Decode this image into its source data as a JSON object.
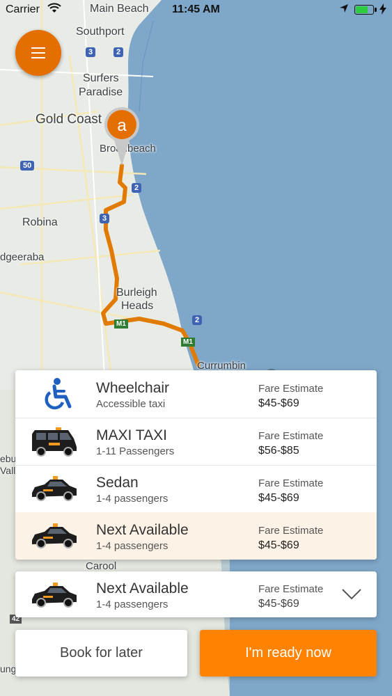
{
  "status_bar": {
    "carrier": "Carrier",
    "time": "11:45 AM"
  },
  "map": {
    "labels": {
      "main_beach": "Main Beach",
      "southport": "Southport",
      "surfers_paradise_1": "Surfers",
      "surfers_paradise_2": "Paradise",
      "gold_coast": "Gold Coast",
      "broadbeach": "Broadbeach",
      "robina": "Robina",
      "mudgeeraba": "dgeeraba",
      "burleigh_1": "Burleigh",
      "burleigh_2": "Heads",
      "currumbin": "Currumbin",
      "carool": "Carool",
      "edge_1": "ebu",
      "edge_2": "Valle",
      "edge_3": "ung"
    },
    "shields": {
      "r3a": "3",
      "r2a": "2",
      "r50": "50",
      "r2b": "2",
      "r3b": "3",
      "r2c": "2",
      "m1a": "M1",
      "m1b": "M1",
      "r42": "42"
    },
    "pin_letter": "a",
    "colors": {
      "route": "#e07a00",
      "water": "#7fa7c9",
      "land": "#e8ebe6",
      "accent": "#ff8200"
    }
  },
  "vehicles": [
    {
      "icon": "wheelchair-icon",
      "name": "Wheelchair",
      "sub": "Accessible taxi",
      "fare_label": "Fare Estimate",
      "fare": "$45-$69"
    },
    {
      "icon": "maxi-taxi-icon",
      "name": "MAXI TAXI",
      "sub": "1-11 Passengers",
      "fare_label": "Fare Estimate",
      "fare": "$56-$85"
    },
    {
      "icon": "sedan-icon",
      "name": "Sedan",
      "sub": "1-4 passengers",
      "fare_label": "Fare Estimate",
      "fare": "$45-$69"
    },
    {
      "icon": "sedan-icon",
      "name": "Next Available",
      "sub": "1-4 passengers",
      "fare_label": "Fare Estimate",
      "fare": "$45-$69"
    }
  ],
  "selected": {
    "icon": "sedan-icon",
    "name": "Next Available",
    "sub": "1-4 passengers",
    "fare_label": "Fare Estimate",
    "fare": "$45-$69"
  },
  "buttons": {
    "book_later": "Book for later",
    "ready_now": "I'm ready now"
  }
}
